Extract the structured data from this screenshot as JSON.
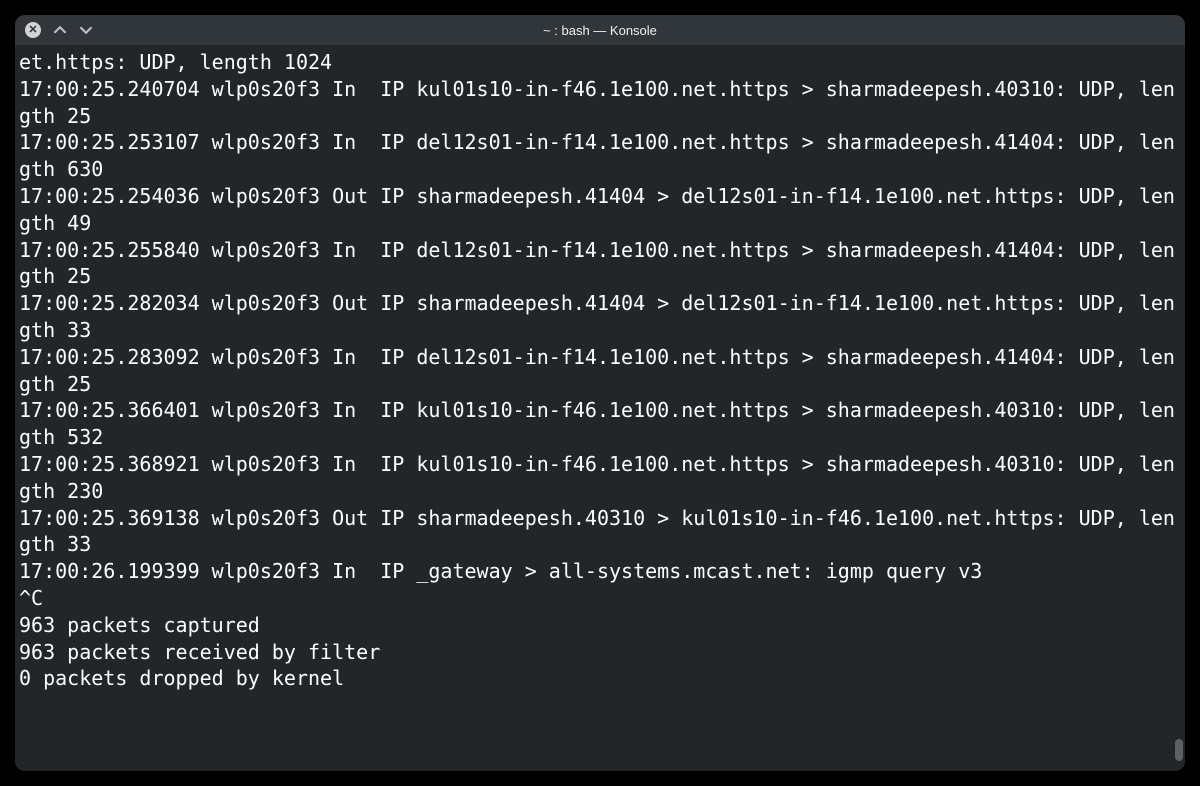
{
  "window": {
    "title": "~ : bash — Konsole"
  },
  "terminal": {
    "lines": [
      "et.https: UDP, length 1024",
      "17:00:25.240704 wlp0s20f3 In  IP kul01s10-in-f46.1e100.net.https > sharmadeepesh.40310: UDP, length 25",
      "17:00:25.253107 wlp0s20f3 In  IP del12s01-in-f14.1e100.net.https > sharmadeepesh.41404: UDP, length 630",
      "17:00:25.254036 wlp0s20f3 Out IP sharmadeepesh.41404 > del12s01-in-f14.1e100.net.https: UDP, length 49",
      "17:00:25.255840 wlp0s20f3 In  IP del12s01-in-f14.1e100.net.https > sharmadeepesh.41404: UDP, length 25",
      "17:00:25.282034 wlp0s20f3 Out IP sharmadeepesh.41404 > del12s01-in-f14.1e100.net.https: UDP, length 33",
      "17:00:25.283092 wlp0s20f3 In  IP del12s01-in-f14.1e100.net.https > sharmadeepesh.41404: UDP, length 25",
      "17:00:25.366401 wlp0s20f3 In  IP kul01s10-in-f46.1e100.net.https > sharmadeepesh.40310: UDP, length 532",
      "17:00:25.368921 wlp0s20f3 In  IP kul01s10-in-f46.1e100.net.https > sharmadeepesh.40310: UDP, length 230",
      "17:00:25.369138 wlp0s20f3 Out IP sharmadeepesh.40310 > kul01s10-in-f46.1e100.net.https: UDP, length 33",
      "17:00:26.199399 wlp0s20f3 In  IP _gateway > all-systems.mcast.net: igmp query v3",
      "^C",
      "963 packets captured",
      "963 packets received by filter",
      "0 packets dropped by kernel"
    ]
  }
}
